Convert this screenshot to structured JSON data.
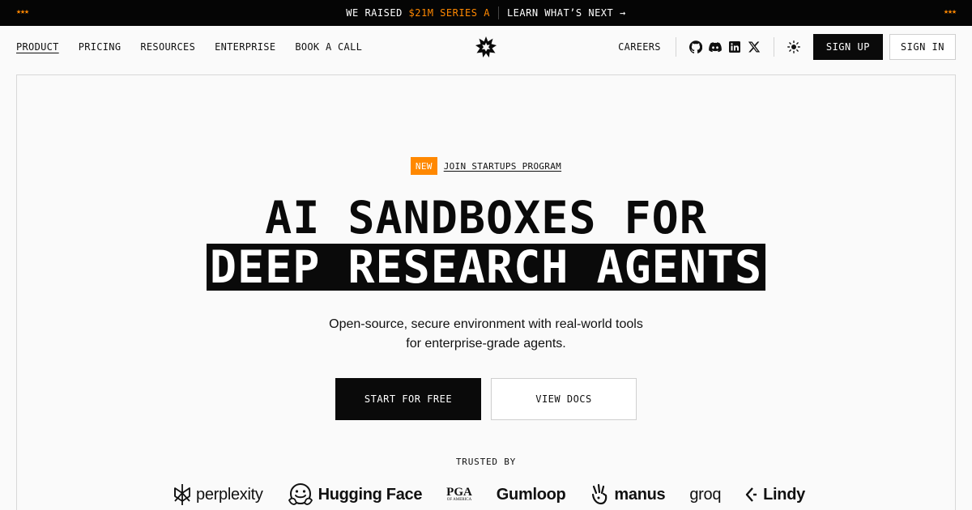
{
  "announcement": {
    "stars_left": "★★★",
    "stars_right": "★★★",
    "raised_prefix": "WE RAISED ",
    "raised_amount": "$21M SERIES A",
    "learn_link": "LEARN WHAT’S NEXT →"
  },
  "nav": {
    "links": [
      "PRODUCT",
      "PRICING",
      "RESOURCES",
      "ENTERPRISE",
      "BOOK A CALL"
    ],
    "careers": "CAREERS",
    "sign_up": "SIGN UP",
    "sign_in": "SIGN IN",
    "social_icons": [
      "github-icon",
      "discord-icon",
      "linkedin-icon",
      "x-icon"
    ]
  },
  "hero": {
    "badge_new": "NEW",
    "badge_link": "JOIN STARTUPS PROGRAM",
    "headline_line1": "AI SANDBOXES FOR",
    "headline_line2": "DEEP RESEARCH AGENTS",
    "subtitle_line1": "Open-source, secure environment with real-world tools",
    "subtitle_line2": "for enterprise-grade agents.",
    "cta_primary": "START FOR FREE",
    "cta_secondary": "VIEW DOCS",
    "trusted_label": "TRUSTED BY"
  },
  "trusted_logos": {
    "perplexity": "perplexity",
    "hugging_face": "Hugging Face",
    "pga": "PGA",
    "pga_sub": "OF AMERICA",
    "gumloop": "Gumloop",
    "manus": "manus",
    "groq": "groq",
    "lindy": "Lindy"
  },
  "colors": {
    "accent": "#ff8800",
    "dark": "#0a0a0a",
    "background": "#fafafa"
  }
}
